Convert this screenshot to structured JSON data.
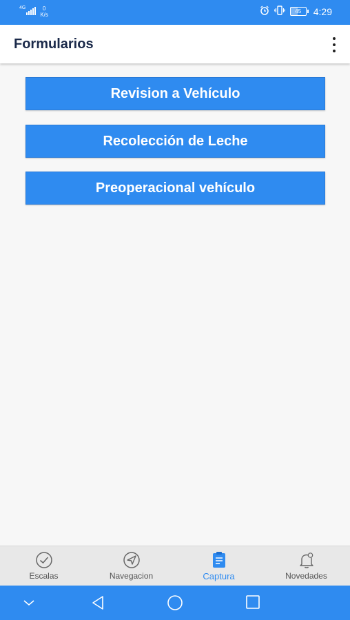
{
  "status_bar": {
    "network_type": "4G",
    "net_speed_value": "0",
    "net_speed_unit": "K/s",
    "battery": "45",
    "time": "4:29"
  },
  "app_bar": {
    "title": "Formularios",
    "menu_icon": "more-vertical-icon"
  },
  "forms": [
    {
      "label": "Revision a Vehículo"
    },
    {
      "label": "Recolección de Leche"
    },
    {
      "label": "Preoperacional vehículo"
    }
  ],
  "tabs": [
    {
      "label": "Escalas",
      "icon": "check-circle-icon",
      "active": false
    },
    {
      "label": "Navegacion",
      "icon": "navigation-icon",
      "active": false
    },
    {
      "label": "Captura",
      "icon": "clipboard-icon",
      "active": true
    },
    {
      "label": "Novedades",
      "icon": "bell-icon",
      "active": false
    }
  ],
  "system_nav": {
    "icons": [
      "chevron-down-icon",
      "back-icon",
      "home-icon",
      "recents-icon"
    ]
  },
  "colors": {
    "primary": "#2f8bf0",
    "active_tab": "#2f8bf0",
    "title": "#1b2a4a"
  }
}
